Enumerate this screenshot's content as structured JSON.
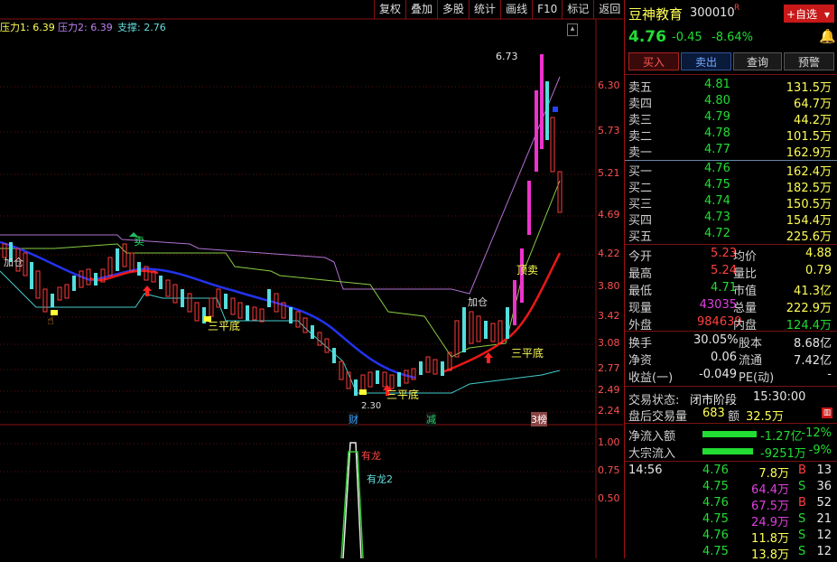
{
  "toolbar": {
    "buttons": [
      "复权",
      "叠加",
      "多股",
      "统计",
      "画线",
      "F10",
      "标记",
      "返回"
    ]
  },
  "legend": {
    "pressure1": "压力1: 6.39",
    "pressure2": "压力2: 6.39",
    "support": "支撑: 2.76"
  },
  "price_axis": [
    "6.30",
    "5.73",
    "5.21",
    "4.69",
    "4.22",
    "3.80",
    "3.42",
    "3.08",
    "2.77",
    "2.49",
    "2.24"
  ],
  "indicator_axis": [
    "1.00",
    "0.75",
    "0.50"
  ],
  "annotations": {
    "high_label": "6.73",
    "low_label": "2.30",
    "sell1": "卖",
    "sell2": "顶卖",
    "flat1": "三平底",
    "flat2": "三平底",
    "flat3": "三平底",
    "sanping": "三平底",
    "jiacang": "加仓",
    "jiacang2": "加仓",
    "dilong": "有龙2",
    "youlong": "有龙",
    "tag_cai": "财",
    "tag_jian": "减",
    "tag_bang": "3榜"
  },
  "stock": {
    "name": "豆神教育",
    "code": "300010",
    "badge": "R",
    "price": "4.76",
    "change": "-0.45",
    "change_pct": "-8.64%",
    "add_watch": "+自选",
    "colors": {
      "up": "#ff4040",
      "down": "#22dd33",
      "panel_line": "#7a1212"
    }
  },
  "actions": [
    "买入",
    "卖出",
    "查询",
    "预警"
  ],
  "sell_orders": [
    {
      "label": "卖五",
      "price": "4.81",
      "vol": "131.5万"
    },
    {
      "label": "卖四",
      "price": "4.80",
      "vol": "64.7万"
    },
    {
      "label": "卖三",
      "price": "4.79",
      "vol": "44.2万"
    },
    {
      "label": "卖二",
      "price": "4.78",
      "vol": "101.5万"
    },
    {
      "label": "卖一",
      "price": "4.77",
      "vol": "162.9万"
    }
  ],
  "buy_orders": [
    {
      "label": "买一",
      "price": "4.76",
      "vol": "162.4万"
    },
    {
      "label": "买二",
      "price": "4.75",
      "vol": "182.5万"
    },
    {
      "label": "买三",
      "price": "4.74",
      "vol": "150.5万"
    },
    {
      "label": "买四",
      "price": "4.73",
      "vol": "154.4万"
    },
    {
      "label": "买五",
      "price": "4.72",
      "vol": "225.6万"
    }
  ],
  "stats": [
    {
      "l1": "今开",
      "v1": "5.23",
      "l2": "均价",
      "v2": "4.88"
    },
    {
      "l1": "最高",
      "v1": "5.24",
      "l2": "量比",
      "v2": "0.79"
    },
    {
      "l1": "最低",
      "v1": "4.71",
      "l2": "市值",
      "v2": "41.3亿"
    },
    {
      "l1": "现量",
      "v1": "43035",
      "l2": "总量",
      "v2": "222.9万"
    },
    {
      "l1": "外盘",
      "v1": "984639",
      "l2": "内盘",
      "v2": "124.4万"
    }
  ],
  "stats2": [
    {
      "l1": "换手",
      "v1": "30.05%",
      "l2": "股本",
      "v2": "8.68亿"
    },
    {
      "l1": "净资",
      "v1": "0.06",
      "l2": "流通",
      "v2": "7.42亿"
    },
    {
      "l1": "收益(一)",
      "v1": "-0.049",
      "l2": "PE(动)",
      "v2": "-"
    }
  ],
  "status": {
    "state_label": "交易状态:",
    "state_value": "闭市阶段",
    "time": "15:30:00",
    "after_label": "盘后交易量",
    "after_vol": "683",
    "amount_label": "额",
    "amount": "32.5万"
  },
  "flows": [
    {
      "label": "净流入额",
      "value": "-1.27亿",
      "pct": "-12%"
    },
    {
      "label": "大宗流入",
      "value": "-9251万",
      "pct": "-9%"
    }
  ],
  "ticks": [
    {
      "time": "14:56",
      "price": "4.76",
      "vol": "7.8万",
      "side": "B",
      "n": "13"
    },
    {
      "time": "",
      "price": "4.75",
      "vol": "64.4万",
      "side": "S",
      "n": "36"
    },
    {
      "time": "",
      "price": "4.76",
      "vol": "67.5万",
      "side": "B",
      "n": "52"
    },
    {
      "time": "",
      "price": "4.75",
      "vol": "24.9万",
      "side": "S",
      "n": "21"
    },
    {
      "time": "",
      "price": "4.76",
      "vol": "11.8万",
      "side": "S",
      "n": "12"
    },
    {
      "time": "",
      "price": "4.75",
      "vol": "13.8万",
      "side": "S",
      "n": "12"
    }
  ]
}
